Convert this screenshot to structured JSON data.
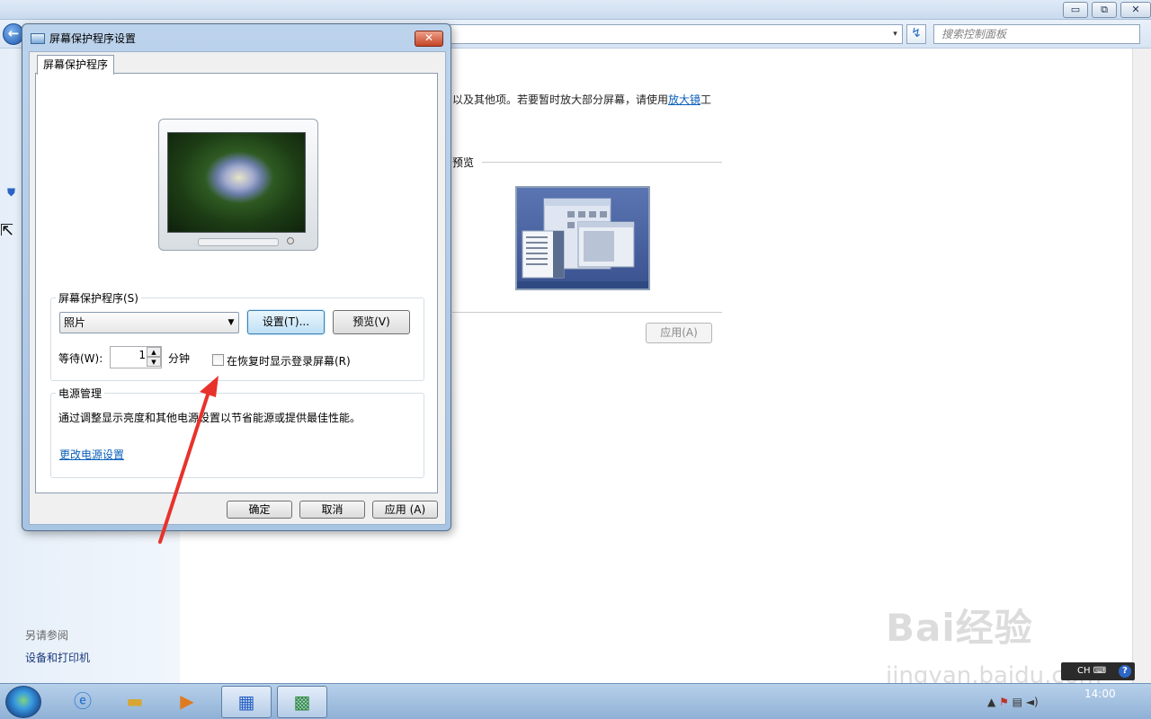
{
  "window_buttons": {
    "minimize": "▭",
    "restore": "⧉",
    "close": "✕"
  },
  "address_bar": {
    "dropdown_glyph": "▾",
    "refresh_glyph": "↯"
  },
  "search": {
    "placeholder": "搜索控制面板"
  },
  "control_panel": {
    "desc_text": "以及其他项。若要暂时放大部分屏幕，请使用",
    "desc_link": "放大镜",
    "desc_tail": "工",
    "preview_label": "预览",
    "apply_label": "应用(A)",
    "see_also": "另请参阅",
    "devices_link": "设备和打印机"
  },
  "dialog": {
    "title": "屏幕保护程序设置",
    "close_glyph": "✕",
    "tab_label": "屏幕保护程序",
    "group_screensaver": {
      "title": "屏幕保护程序(S)",
      "selected": "照片",
      "settings_button": "设置(T)...",
      "preview_button": "预览(V)",
      "wait_label": "等待(W):",
      "wait_value": "1",
      "minutes_label": "分钟",
      "resume_checkbox": "在恢复时显示登录屏幕(R)",
      "resume_checked": false
    },
    "group_power": {
      "title": "电源管理",
      "description": "通过调整显示亮度和其他电源设置以节省能源或提供最佳性能。",
      "link": "更改电源设置"
    },
    "buttons": {
      "ok": "确定",
      "cancel": "取消",
      "apply": "应用 (A)"
    }
  },
  "taskbar": {
    "clock": "14:00",
    "lang": "CH",
    "items": [
      "ie-icon",
      "folder-icon",
      "media-player-icon",
      "control-panel-icon",
      "screensaver-icon"
    ]
  },
  "watermark": {
    "line1": "Bai经验",
    "line2": "jingyan.baidu.com"
  },
  "colors": {
    "accent_link": "#0b5fba",
    "annotation_arrow": "#e8322c"
  }
}
